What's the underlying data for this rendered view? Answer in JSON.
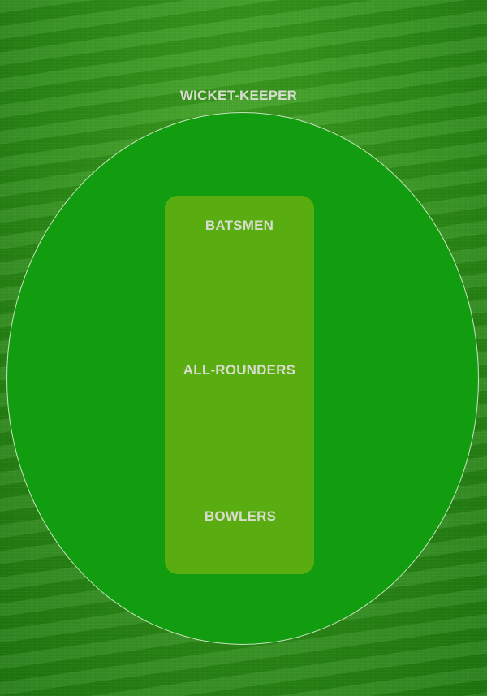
{
  "positions": {
    "wicket_keeper": "WICKET-KEEPER",
    "batsmen": "BATSMEN",
    "all_rounders": "ALL-ROUNDERS",
    "bowlers": "BOWLERS"
  },
  "colors": {
    "outfield": "#2b8f14",
    "inner_circle": "#129d10",
    "pitch": "#5aad10",
    "label_text": "#d7dccf",
    "boundary_line": "#e6f0dc"
  }
}
